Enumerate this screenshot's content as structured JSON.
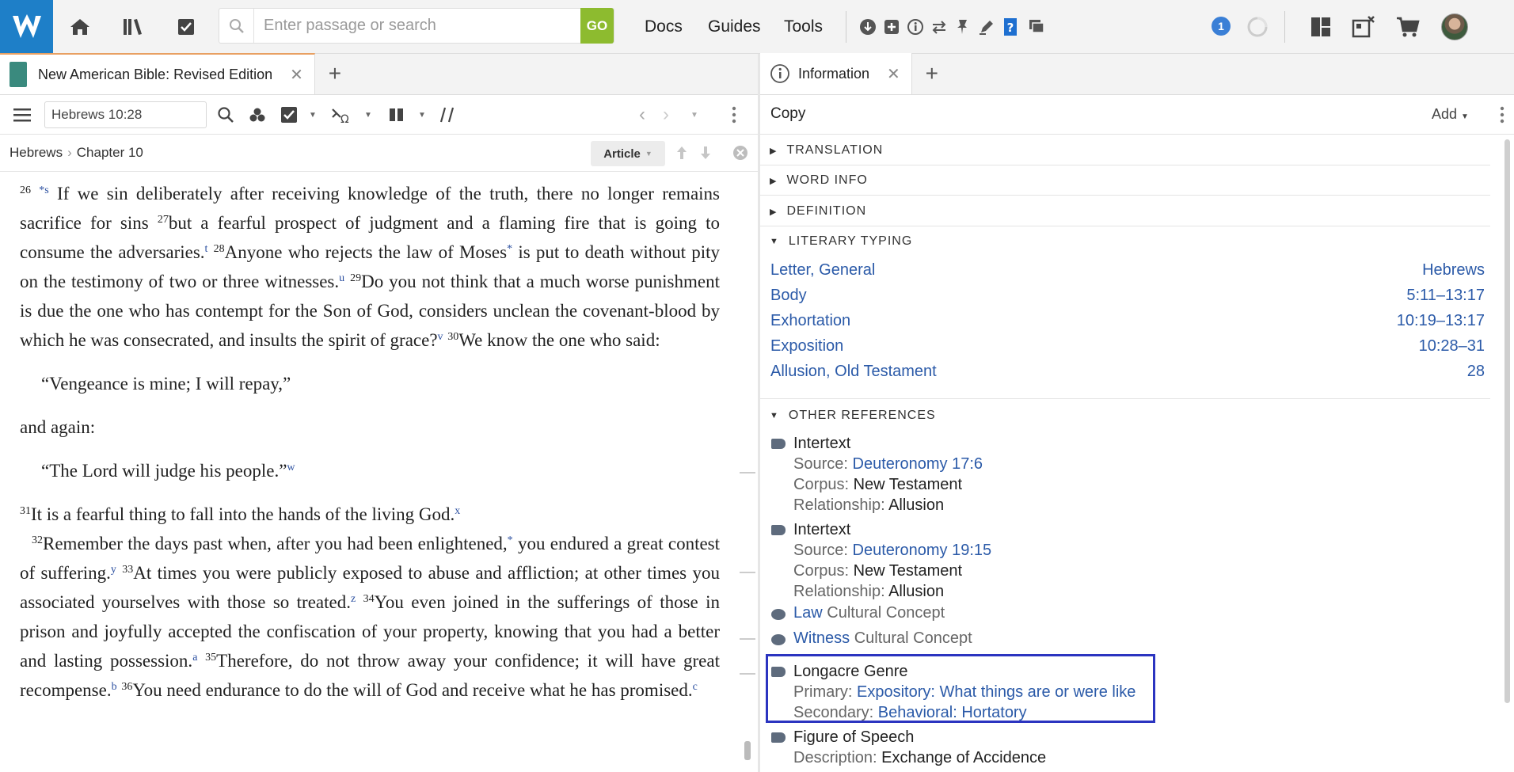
{
  "topbar": {
    "search_placeholder": "Enter passage or search",
    "go_label": "GO",
    "menus": [
      "Docs",
      "Guides",
      "Tools"
    ],
    "notification_count": "1",
    "icons": [
      "home-icon",
      "library-icon",
      "tasks-icon",
      "download-icon",
      "puzzle-icon",
      "info-icon",
      "sync-icon",
      "pin-icon",
      "highlighter-icon",
      "help-icon",
      "windows-icon",
      "layout-icon",
      "close-layout-icon",
      "cart-icon"
    ]
  },
  "left": {
    "tab_title": "New American Bible: Revised Edition",
    "ref_value": "Hebrews 10:28",
    "breadcrumb": {
      "book": "Hebrews",
      "chapter": "Chapter 10"
    },
    "article_label": "Article",
    "bible": {
      "v26_num": "26",
      "v26_mark": "*s",
      "v26": "If we sin deliberately after receiving knowledge of the truth, there no longer remains sacrifice for sins",
      "v27_num": "27",
      "v27": "but a fearful prospect of judgment and a flaming fire that is going to consume the adversaries.",
      "fn_t": "t",
      "v28_num": "28",
      "v28a": "Anyone who rejects the law of Moses",
      "star": "*",
      "v28b": "is put to death without pity on the testimony of two or three witnesses.",
      "fn_u": "u",
      "v29_num": "29",
      "v29": "Do you not think that a much worse punishment is due the one who has contempt for the Son of God, considers unclean the covenant-blood by which he was consecrated, and insults the spirit of grace?",
      "fn_v": "v",
      "v30_num": "30",
      "v30": "We know the one who said:",
      "quote1": "“Vengeance is mine; I will repay,”",
      "and_again": "and again:",
      "quote2": "“The Lord will judge his people.”",
      "fn_w": "w",
      "v31_num": "31",
      "v31": "It is a fearful thing to fall into the hands of the living God.",
      "fn_x": "x",
      "v32_num": "32",
      "v32a": "Remember the days past when, after you had been enlightened,",
      "v32b": "you endured a great contest of suffering.",
      "fn_y": "y",
      "v33_num": "33",
      "v33": "At times you were publicly exposed to abuse and affliction; at other times you associated yourselves with those so treated.",
      "fn_z": "z",
      "v34_num": "34",
      "v34": "You even joined in the sufferings of those in prison and joyfully accepted the confiscation of your property, knowing that you had a better and lasting possession.",
      "fn_a": "a",
      "v35_num": "35",
      "v35": "Therefore, do not throw away your confidence; it will have great recompense.",
      "fn_b": "b",
      "v36_num": "36",
      "v36": "You need endurance to do the will of God and receive what he has promised.",
      "fn_c": "c"
    }
  },
  "right": {
    "tab_title": "Information",
    "copy_label": "Copy",
    "add_label": "Add",
    "sections": {
      "translation": "TRANSLATION",
      "word_info": "WORD INFO",
      "definition": "DEFINITION",
      "literary_typing": "LITERARY TYPING",
      "other_references": "OTHER REFERENCES"
    },
    "literary_typing": [
      {
        "label": "Letter, General",
        "range": "Hebrews"
      },
      {
        "label": "Body",
        "range": "5:11–13:17"
      },
      {
        "label": "Exhortation",
        "range": "10:19–13:17"
      },
      {
        "label": "Exposition",
        "range": "10:28–31"
      },
      {
        "label": "Allusion, Old Testament",
        "range": "28"
      }
    ],
    "other_references": {
      "intertext1": {
        "title": "Intertext",
        "source_k": "Source:",
        "source_v": "Deuteronomy 17:6",
        "corpus_k": "Corpus:",
        "corpus_v": "New Testament",
        "rel_k": "Relationship:",
        "rel_v": "Allusion"
      },
      "intertext2": {
        "title": "Intertext",
        "source_k": "Source:",
        "source_v": "Deuteronomy 19:15",
        "corpus_k": "Corpus:",
        "corpus_v": "New Testament",
        "rel_k": "Relationship:",
        "rel_v": "Allusion"
      },
      "law": {
        "link": "Law",
        "type": "Cultural Concept"
      },
      "witness": {
        "link": "Witness",
        "type": "Cultural Concept"
      },
      "longacre": {
        "title": "Longacre Genre",
        "primary_k": "Primary:",
        "primary_v": "Expository: What things are or were like",
        "secondary_k": "Secondary:",
        "secondary_v": "Behavioral: Hortatory"
      },
      "figure": {
        "title": "Figure of Speech",
        "desc_k": "Description:",
        "desc_v": "Exchange of Accidence"
      }
    }
  }
}
